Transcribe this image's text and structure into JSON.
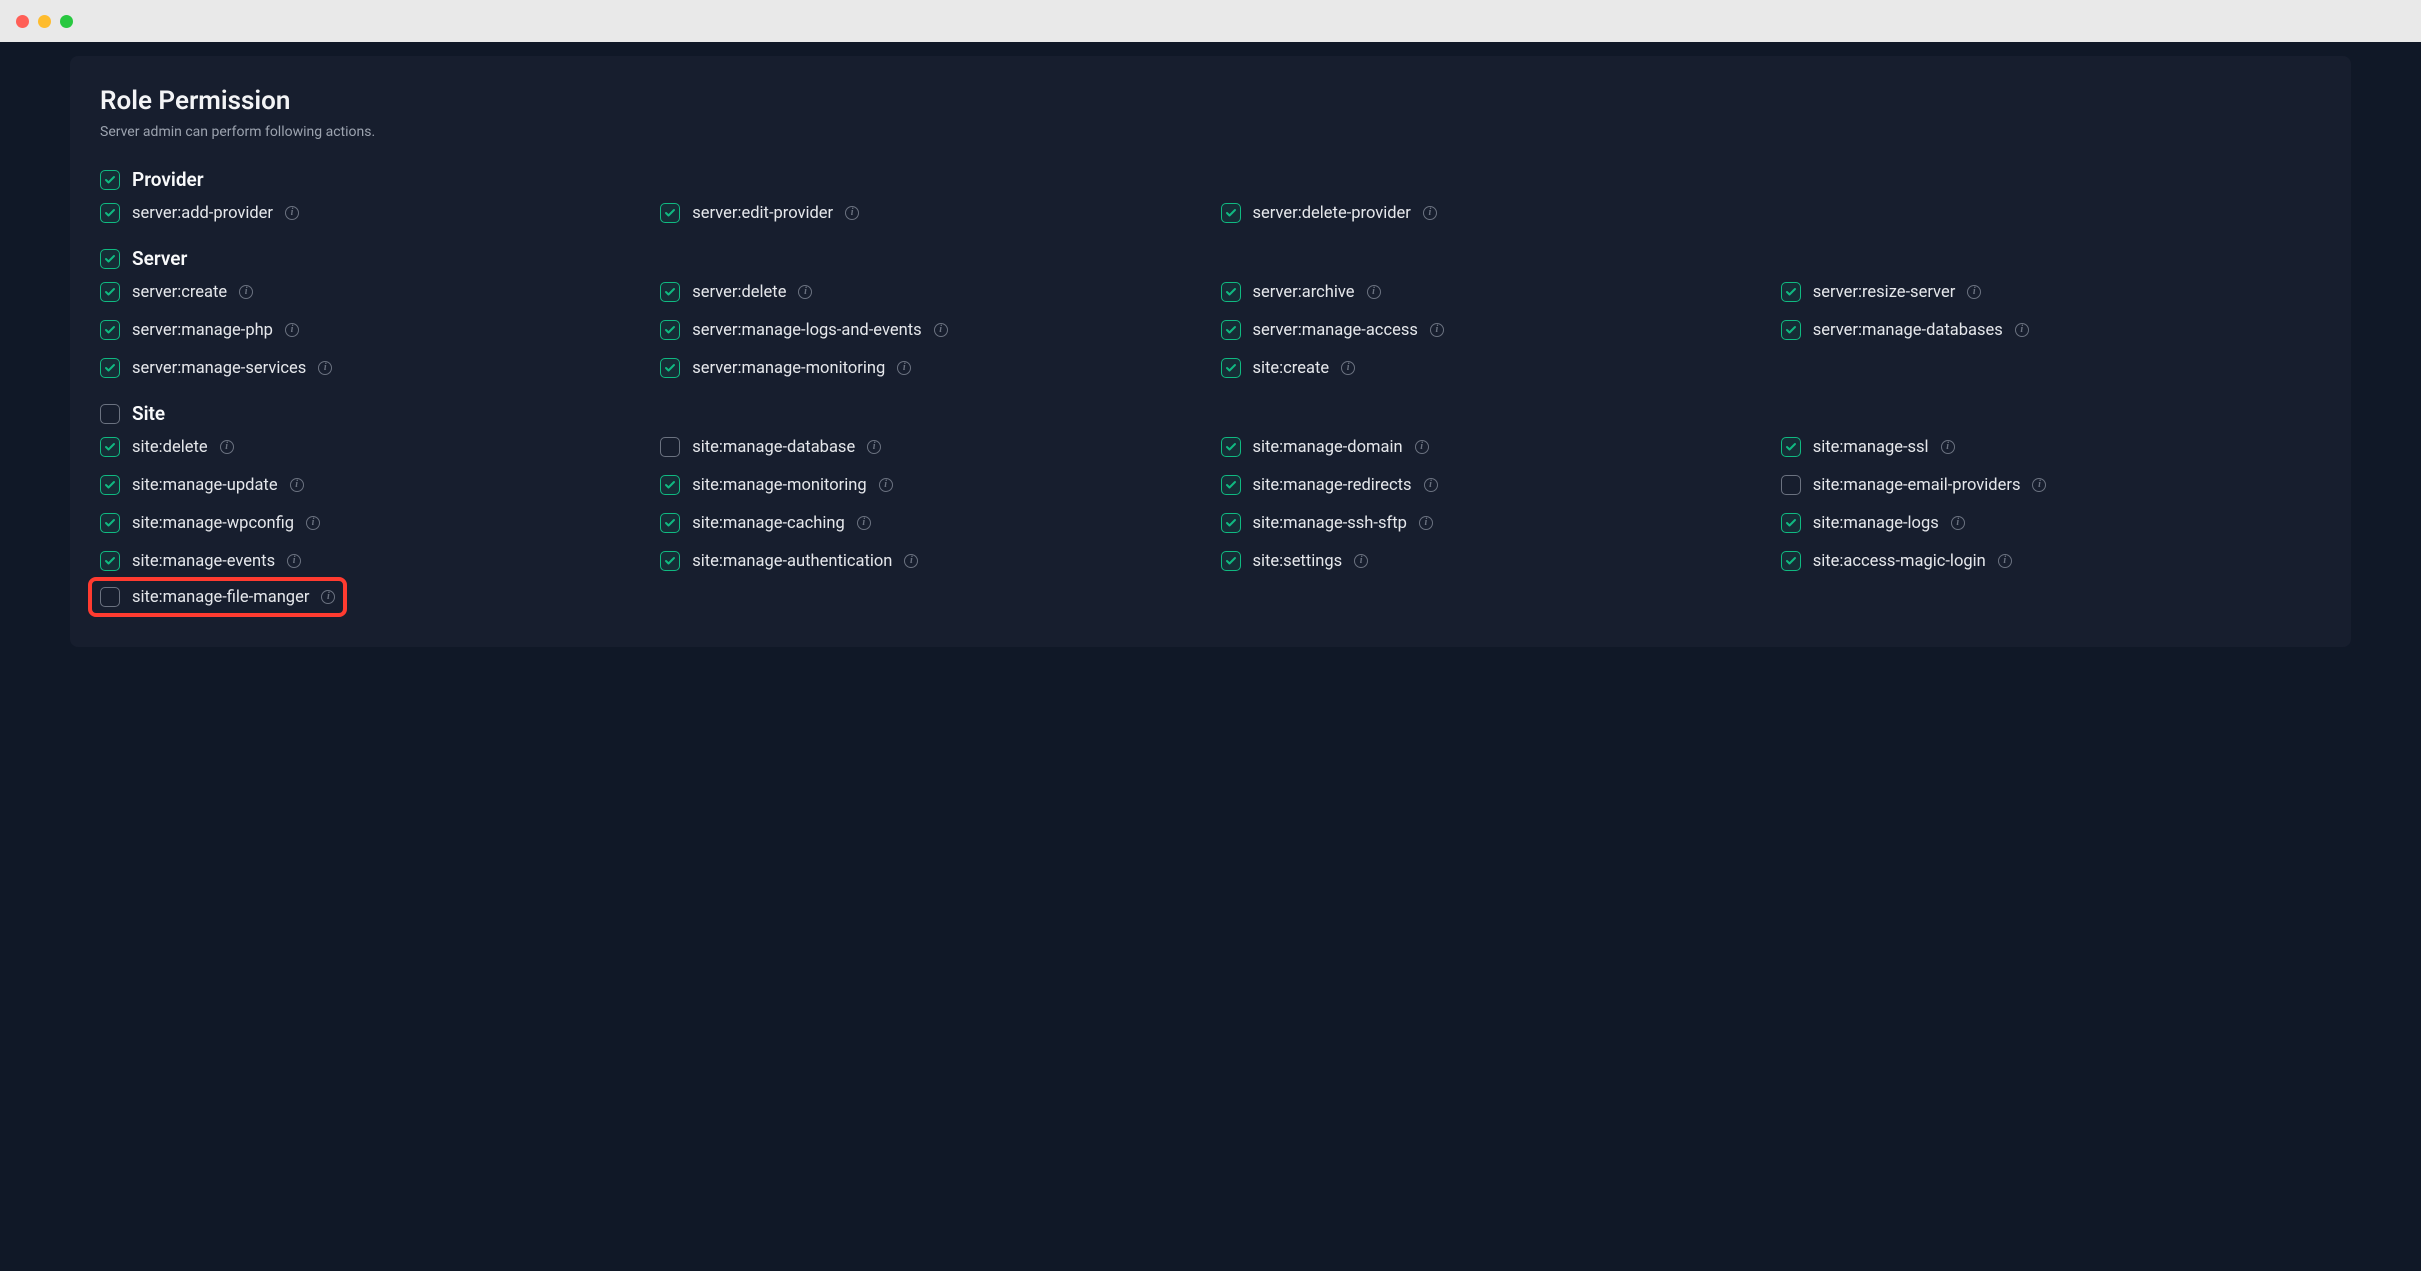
{
  "header": {
    "title": "Role Permission",
    "subtitle": "Server admin can perform following actions."
  },
  "sections": [
    {
      "key": "provider",
      "title": "Provider",
      "checked": true,
      "items": [
        {
          "label": "server:add-provider",
          "checked": true,
          "info": true
        },
        {
          "label": "server:edit-provider",
          "checked": true,
          "info": true
        },
        {
          "label": "server:delete-provider",
          "checked": true,
          "info": true
        }
      ]
    },
    {
      "key": "server",
      "title": "Server",
      "checked": true,
      "items": [
        {
          "label": "server:create",
          "checked": true,
          "info": true
        },
        {
          "label": "server:delete",
          "checked": true,
          "info": true
        },
        {
          "label": "server:archive",
          "checked": true,
          "info": true
        },
        {
          "label": "server:resize-server",
          "checked": true,
          "info": true
        },
        {
          "label": "server:manage-php",
          "checked": true,
          "info": true
        },
        {
          "label": "server:manage-logs-and-events",
          "checked": true,
          "info": true
        },
        {
          "label": "server:manage-access",
          "checked": true,
          "info": true
        },
        {
          "label": "server:manage-databases",
          "checked": true,
          "info": true
        },
        {
          "label": "server:manage-services",
          "checked": true,
          "info": true
        },
        {
          "label": "server:manage-monitoring",
          "checked": true,
          "info": true
        },
        {
          "label": "site:create",
          "checked": true,
          "info": true
        }
      ]
    },
    {
      "key": "site",
      "title": "Site",
      "checked": false,
      "items": [
        {
          "label": "site:delete",
          "checked": true,
          "info": true
        },
        {
          "label": "site:manage-database",
          "checked": false,
          "info": true
        },
        {
          "label": "site:manage-domain",
          "checked": true,
          "info": true
        },
        {
          "label": "site:manage-ssl",
          "checked": true,
          "info": true
        },
        {
          "label": "site:manage-update",
          "checked": true,
          "info": true
        },
        {
          "label": "site:manage-monitoring",
          "checked": true,
          "info": true
        },
        {
          "label": "site:manage-redirects",
          "checked": true,
          "info": true
        },
        {
          "label": "site:manage-email-providers",
          "checked": false,
          "info": true
        },
        {
          "label": "site:manage-wpconfig",
          "checked": true,
          "info": true
        },
        {
          "label": "site:manage-caching",
          "checked": true,
          "info": true
        },
        {
          "label": "site:manage-ssh-sftp",
          "checked": true,
          "info": true
        },
        {
          "label": "site:manage-logs",
          "checked": true,
          "info": true
        },
        {
          "label": "site:manage-events",
          "checked": true,
          "info": true
        },
        {
          "label": "site:manage-authentication",
          "checked": true,
          "info": true
        },
        {
          "label": "site:settings",
          "checked": true,
          "info": true
        },
        {
          "label": "site:access-magic-login",
          "checked": true,
          "info": true
        },
        {
          "label": "site:manage-file-manger",
          "checked": false,
          "info": true,
          "highlight": true
        }
      ]
    }
  ]
}
